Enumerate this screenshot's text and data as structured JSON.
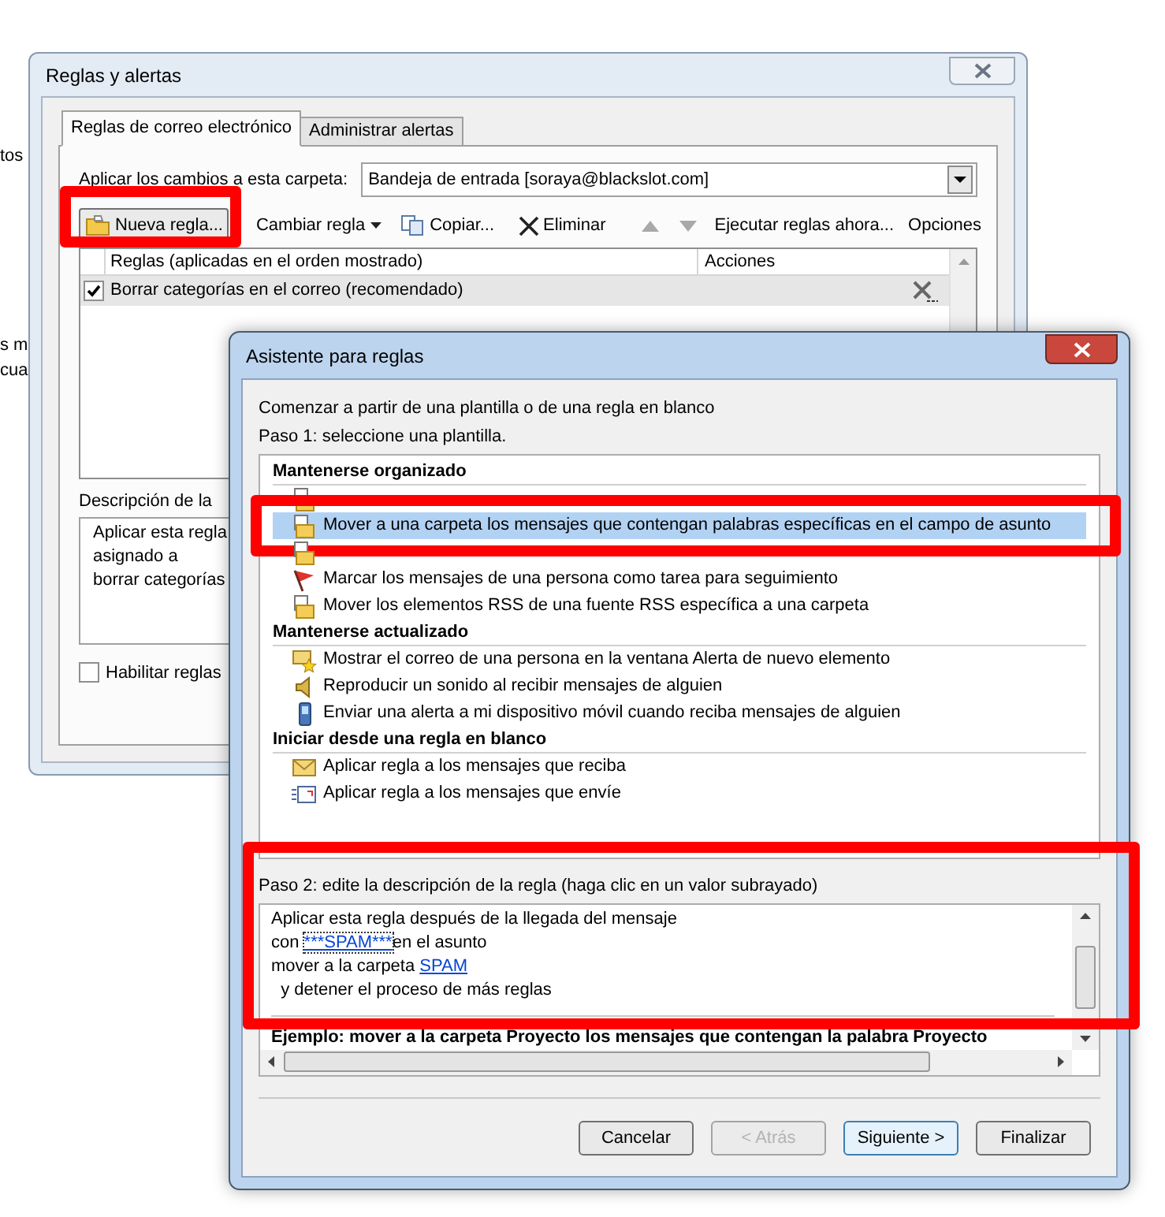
{
  "background_texts": [
    "tos",
    "s m",
    "cua"
  ],
  "rules_window": {
    "title": "Reglas y alertas",
    "tabs": [
      {
        "label": "Reglas de correo electrónico",
        "selected": true
      },
      {
        "label": "Administrar alertas",
        "selected": false
      }
    ],
    "folder_label": "Aplicar los cambios a esta carpeta:",
    "folder_value": "Bandeja de entrada [soraya@blackslot.com]",
    "toolbar": [
      {
        "kind": "new",
        "label": "Nueva regla...",
        "highlighted": true
      },
      {
        "kind": "menu",
        "label": "Cambiar regla"
      },
      {
        "kind": "copy",
        "label": "Copiar..."
      },
      {
        "kind": "delete",
        "label": "Eliminar"
      },
      {
        "kind": "separator"
      },
      {
        "kind": "move_up"
      },
      {
        "kind": "move_down"
      },
      {
        "kind": "text",
        "label": "Ejecutar reglas ahora..."
      },
      {
        "kind": "text",
        "label": "Opciones"
      }
    ],
    "columns": [
      "Reglas (aplicadas en el orden mostrado)",
      "Acciones"
    ],
    "rules": [
      {
        "label": "Borrar categorías en el correo (recomendado)",
        "checked": true,
        "selected": true
      }
    ],
    "description_label": "Descripción de la",
    "description_lines": [
      "Aplicar esta regla",
      "asignado a",
      "borrar categorías"
    ],
    "enable_option": {
      "label": "Habilitar reglas",
      "checked": false
    }
  },
  "wizard": {
    "title": "Asistente para reglas",
    "intro": "Comenzar a partir de una plantilla o de una regla en blanco",
    "step1": "Paso 1: seleccione una plantilla.",
    "groups": [
      {
        "title": "Mantenerse organizado",
        "items": [
          {
            "kind": "move",
            "selected": false
          },
          {
            "kind": "move",
            "label": "Mover a una carpeta los mensajes que contengan palabras específicas en el campo de asunto",
            "selected": true,
            "highlighted": true
          },
          {
            "kind": "move",
            "selected": false
          },
          {
            "kind": "flag",
            "label": "Marcar los mensajes de una persona como tarea para seguimiento",
            "selected": false
          },
          {
            "kind": "move",
            "label": "Mover los elementos RSS de una fuente RSS específica a una carpeta",
            "selected": false
          }
        ]
      },
      {
        "title": "Mantenerse actualizado",
        "items": [
          {
            "kind": "alert",
            "label": "Mostrar el correo de una persona en la ventana Alerta de nuevo elemento",
            "selected": false
          },
          {
            "kind": "speaker",
            "label": "Reproducir un sonido al recibir mensajes de alguien",
            "selected": false
          },
          {
            "kind": "phone",
            "label": "Enviar una alerta a mi dispositivo móvil cuando reciba mensajes de alguien",
            "selected": false
          }
        ]
      },
      {
        "title": "Iniciar desde una regla en blanco",
        "items": [
          {
            "kind": "envelope",
            "label": "Aplicar regla a los mensajes que reciba",
            "selected": false
          },
          {
            "kind": "send",
            "label": "Aplicar regla a los mensajes que envíe",
            "selected": false
          }
        ]
      }
    ],
    "step2": "Paso 2: edite la descripción de la regla (haga clic en un valor subrayado)",
    "description_lines": [
      [
        {
          "kind": "text",
          "text": "Aplicar esta regla después de la llegada del mensaje"
        }
      ],
      [
        {
          "kind": "text",
          "text": "con "
        },
        {
          "kind": "link",
          "text": "***SPAM***",
          "focused": true
        },
        {
          "kind": "text",
          "text": "en el asunto"
        }
      ],
      [
        {
          "kind": "text",
          "text": "mover a la carpeta "
        },
        {
          "kind": "link",
          "text": "SPAM",
          "focused": false
        }
      ],
      [
        {
          "kind": "text",
          "text": "  y detener el proceso de más reglas"
        }
      ]
    ],
    "example": "Ejemplo: mover a la carpeta Proyecto los mensajes que contengan la palabra Proyecto",
    "buttons": [
      {
        "label": "Cancelar",
        "disabled": false,
        "default": false
      },
      {
        "label": "< Atrás",
        "disabled": true,
        "default": false
      },
      {
        "label": "Siguiente >",
        "disabled": false,
        "default": true
      },
      {
        "label": "Finalizar",
        "disabled": false,
        "default": false
      }
    ]
  }
}
